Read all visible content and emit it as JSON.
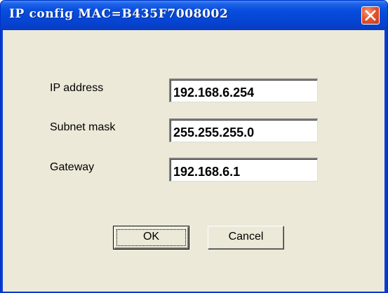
{
  "window": {
    "title": "IP config MAC=B435F7008002"
  },
  "titlebar": {
    "close_icon": "close-icon"
  },
  "form": {
    "ip_address": {
      "label": "IP address",
      "value": "192.168.6.254"
    },
    "subnet_mask": {
      "label": "Subnet mask",
      "value": "255.255.255.0"
    },
    "gateway": {
      "label": "Gateway",
      "value": "192.168.6.1"
    }
  },
  "buttons": {
    "ok_label": "OK",
    "cancel_label": "Cancel"
  },
  "colors": {
    "titlebar": "#0a4fe0",
    "client_background": "#ece9d8",
    "close_button": "#e4542f"
  }
}
